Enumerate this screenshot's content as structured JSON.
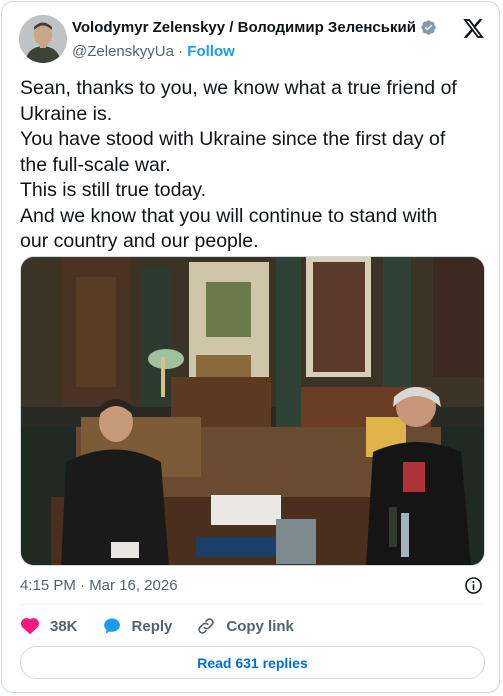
{
  "author": {
    "display_name": "Volodymyr Zelenskyy / Володимир Зеленський",
    "handle": "@ZelenskyyUa",
    "separator": "·",
    "follow_label": "Follow",
    "verified_color": "#829aab"
  },
  "tweet": {
    "lines": [
      "Sean, thanks to you, we know what a true friend of",
      "Ukraine is.",
      "You have stood with Ukraine since the first day of",
      "the full-scale war.",
      "This is still true today.",
      "And we know that you will continue to stand with",
      "our country and our people."
    ],
    "timestamp": "4:15 PM · Mar 16, 2026"
  },
  "actions": {
    "like_count": "38K",
    "reply_label": "Reply",
    "copy_label": "Copy link",
    "like_color": "#f91880",
    "reply_color": "#1d9bf0"
  },
  "read_replies_label": "Read 631 replies",
  "icons": {
    "brand": "x-logo-icon",
    "verified": "verified-badge-icon",
    "info": "info-icon",
    "like": "heart-icon",
    "reply": "reply-bubble-icon",
    "copy": "link-icon"
  }
}
